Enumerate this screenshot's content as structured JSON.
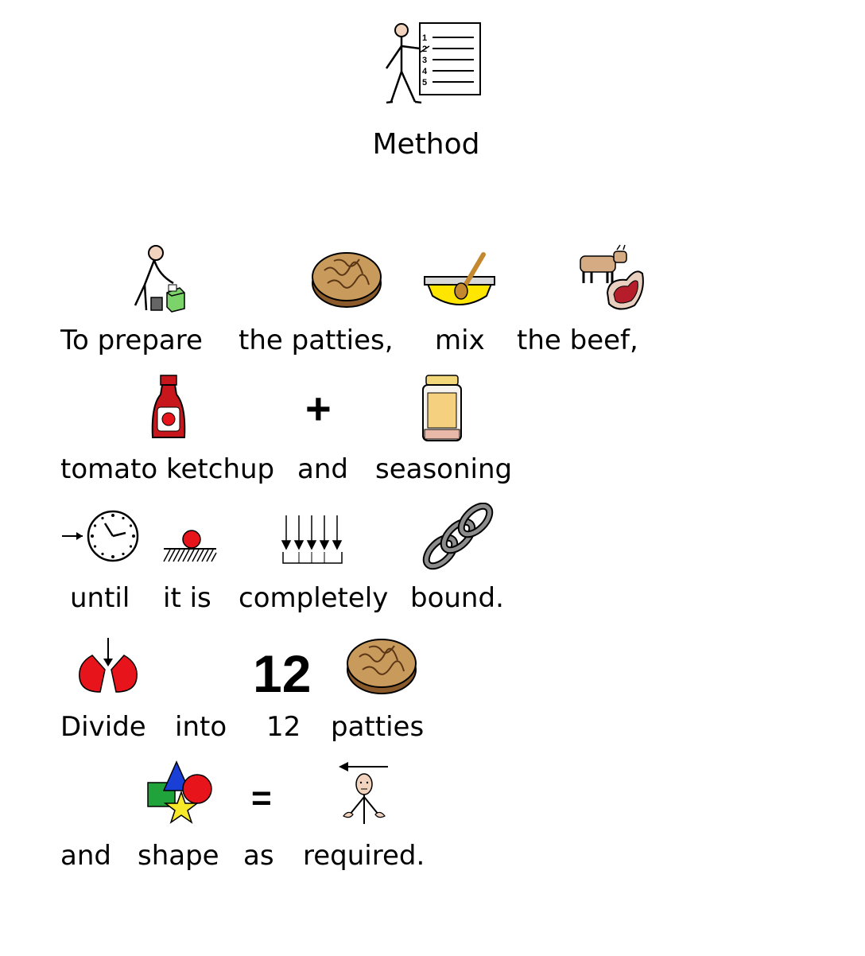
{
  "title": "Method",
  "rows": [
    [
      "To prepare",
      "the patties,",
      "mix",
      "the beef,"
    ],
    [
      "tomato ketchup",
      "and",
      "seasoning"
    ],
    [
      "until",
      "it is",
      "completely",
      "bound."
    ],
    [
      "Divide",
      "into",
      "12",
      "patties"
    ],
    [
      "and",
      "shape",
      "as",
      "required."
    ]
  ],
  "symbols": {
    "plus": "+",
    "twelve": "12",
    "equals": "=",
    "list_numbers": [
      "1",
      "2",
      "3",
      "4",
      "5"
    ]
  },
  "colors": {
    "red": "#e8141c",
    "blue": "#1a3fd6",
    "green": "#1fa33a",
    "yellow": "#f7e82a",
    "brown": "#8a5a2b",
    "ketchup": "#c8161d"
  }
}
